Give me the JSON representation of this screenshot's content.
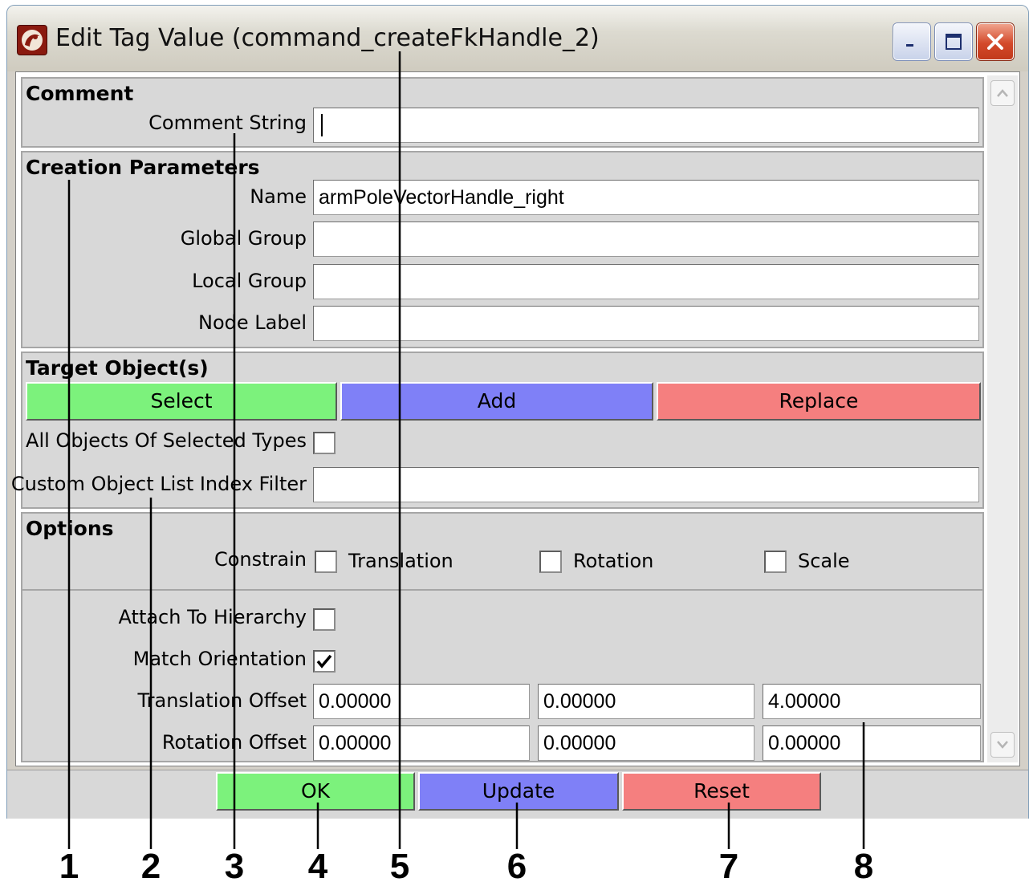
{
  "window": {
    "title": "Edit Tag Value (command_createFkHandle_2)",
    "controls": [
      "minimize-icon",
      "maximize-icon",
      "close-icon"
    ]
  },
  "comment": {
    "header": "Comment",
    "string_label": "Comment String",
    "string_value": ""
  },
  "creation": {
    "header": "Creation Parameters",
    "name_label": "Name",
    "name_value": "armPoleVectorHandle_right",
    "global_group_label": "Global Group",
    "global_group_value": "",
    "local_group_label": "Local Group",
    "local_group_value": "",
    "node_label_label": "Node Label",
    "node_label_value": ""
  },
  "target": {
    "header": "Target Object(s)",
    "select_label": "Select",
    "add_label": "Add",
    "replace_label": "Replace",
    "all_objects_label": "All Objects Of Selected Types",
    "all_objects_checked": false,
    "custom_filter_label": "Custom Object List Index Filter",
    "custom_filter_value": ""
  },
  "options": {
    "header": "Options",
    "constrain_label": "Constrain",
    "translation_label": "Translation",
    "translation_checked": false,
    "rotation_label": "Rotation",
    "rotation_checked": false,
    "scale_label": "Scale",
    "scale_checked": false,
    "attach_label": "Attach To Hierarchy",
    "attach_checked": false,
    "match_label": "Match Orientation",
    "match_checked": true,
    "translation_offset_label": "Translation Offset",
    "translation_offset": [
      "0.00000",
      "0.00000",
      "4.00000"
    ],
    "rotation_offset_label": "Rotation Offset",
    "rotation_offset": [
      "0.00000",
      "0.00000",
      "0.00000"
    ]
  },
  "footer": {
    "ok_label": "OK",
    "update_label": "Update",
    "reset_label": "Reset"
  },
  "colors": {
    "green": "#7cf27c",
    "blue": "#7f80f7",
    "red": "#f57f7f"
  },
  "callouts": [
    "1",
    "2",
    "3",
    "4",
    "5",
    "6",
    "7",
    "8"
  ]
}
